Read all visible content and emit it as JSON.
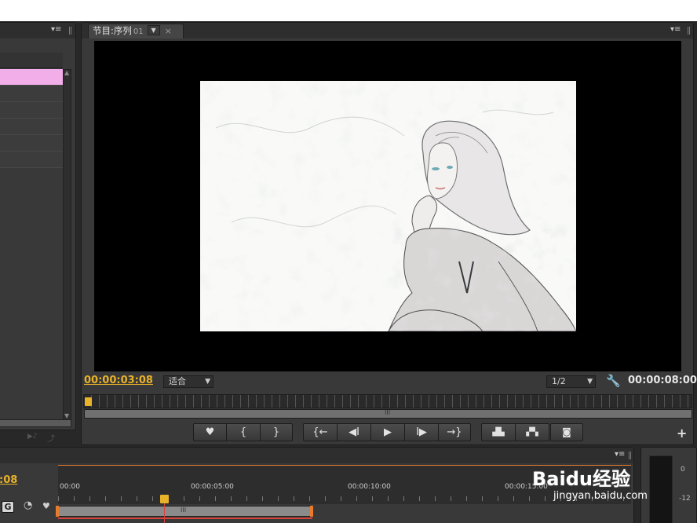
{
  "program_monitor": {
    "tab_label": "节目:序列",
    "tab_sequence": "01",
    "timecode_current": "00:00:03:08",
    "zoom_select": "适合",
    "resolution_select": "1/2",
    "timecode_duration": "00:00:08:00",
    "scroll_handle": "III"
  },
  "transport_controls": {
    "add_marker": "♥",
    "mark_in": "{",
    "mark_out": "}",
    "go_to_in": "{←",
    "step_back": "◀I",
    "play": "▶",
    "step_forward": "I▶",
    "go_to_out": "→}",
    "lift": "▟▙",
    "extract": "▞▚",
    "export_frame": "◙",
    "add_button": "+"
  },
  "timeline": {
    "timecode_partial": ":08",
    "ruler_labels": [
      "00:00",
      "00:00:05:00",
      "00:00:10:00",
      "00:00:15:00"
    ],
    "work_area_handle": "III"
  },
  "audio_meter": {
    "labels": [
      "0",
      "-12"
    ]
  },
  "watermark": {
    "brand": "Baidu经验",
    "url": "jingyan.baidu.com"
  },
  "colors": {
    "accent_timecode": "#e8b22a",
    "selection_row": "#f1aee8",
    "panel_bg": "#393939"
  }
}
